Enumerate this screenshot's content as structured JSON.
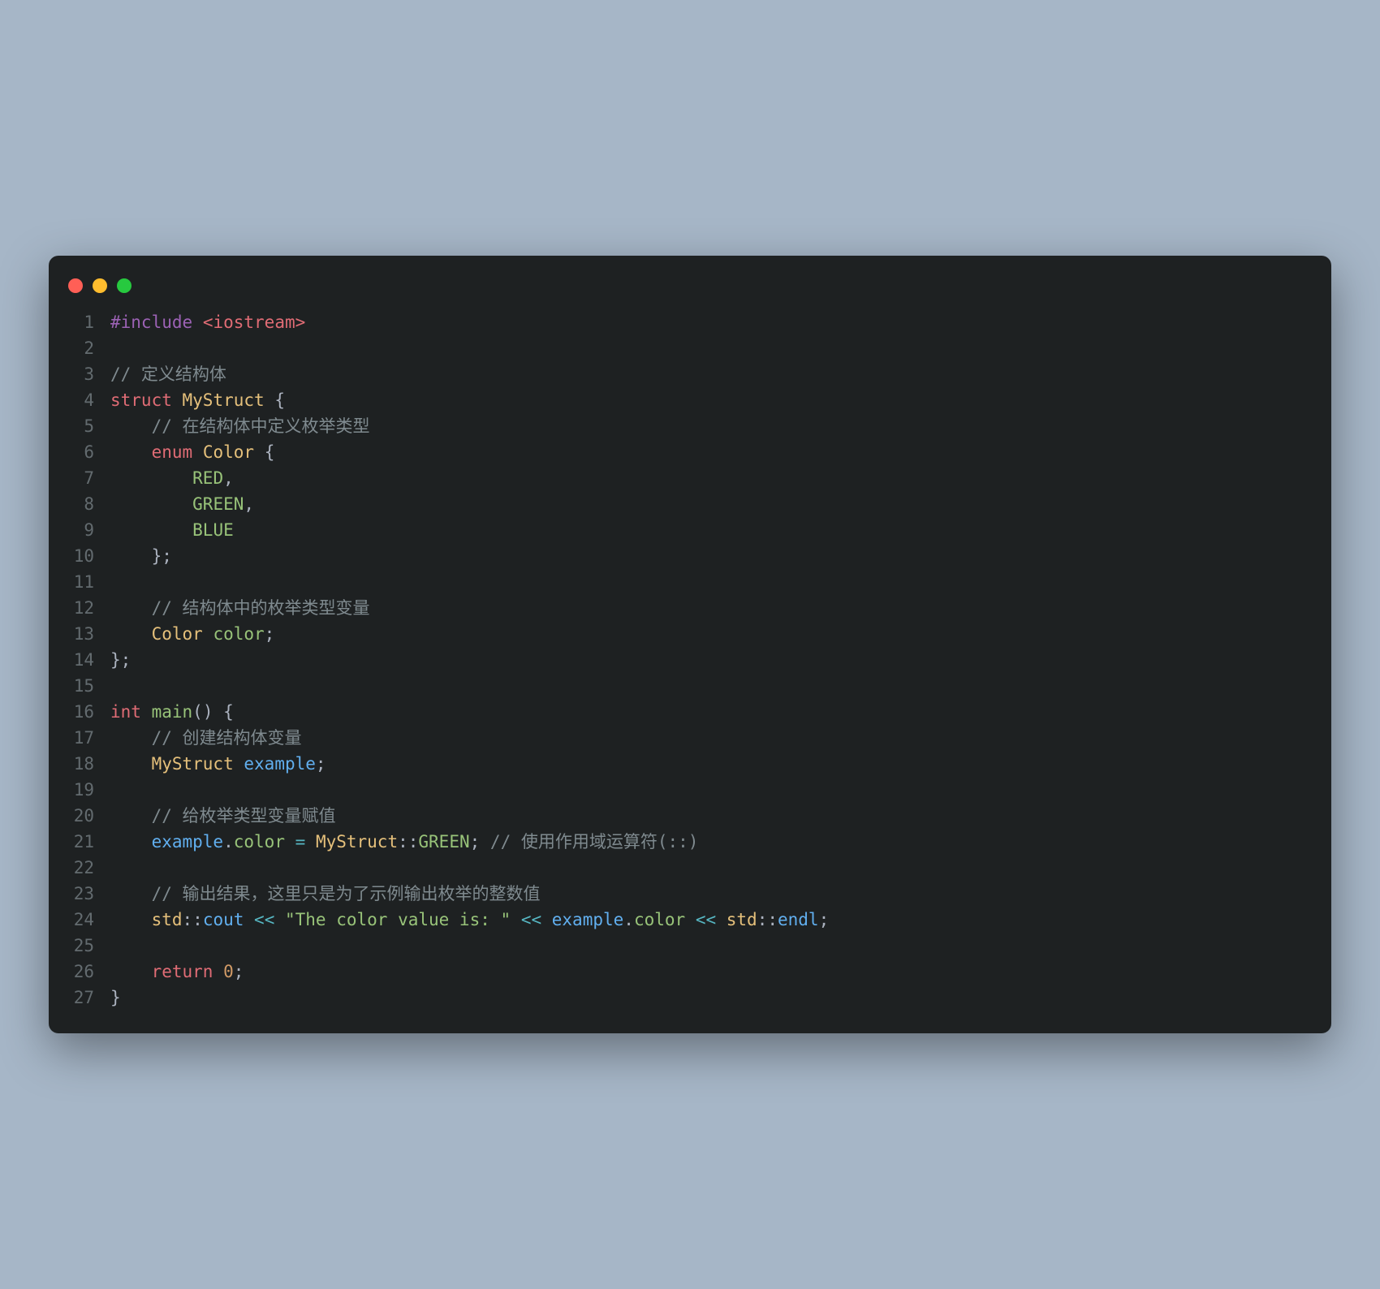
{
  "window": {
    "traffic": [
      "red",
      "yellow",
      "green"
    ]
  },
  "lines": [
    {
      "n": "1",
      "html": "<span class='preproc'>#include</span> <span class='include-path'>&lt;iostream&gt;</span>"
    },
    {
      "n": "2",
      "html": ""
    },
    {
      "n": "3",
      "html": "<span class='comment'>// 定义结构体</span>"
    },
    {
      "n": "4",
      "html": "<span class='keyword-red'>struct</span> <span class='type'>MyStruct</span> <span class='punct'>{</span>"
    },
    {
      "n": "5",
      "html": "    <span class='comment'>// 在结构体中定义枚举类型</span>"
    },
    {
      "n": "6",
      "html": "    <span class='keyword-red'>enum</span> <span class='type'>Color</span> <span class='punct'>{</span>"
    },
    {
      "n": "7",
      "html": "        <span class='const'>RED</span><span class='punct'>,</span>"
    },
    {
      "n": "8",
      "html": "        <span class='const'>GREEN</span><span class='punct'>,</span>"
    },
    {
      "n": "9",
      "html": "        <span class='const'>BLUE</span>"
    },
    {
      "n": "10",
      "html": "    <span class='punct'>};</span>"
    },
    {
      "n": "11",
      "html": ""
    },
    {
      "n": "12",
      "html": "    <span class='comment'>// 结构体中的枚举类型变量</span>"
    },
    {
      "n": "13",
      "html": "    <span class='type'>Color</span> <span class='member'>color</span><span class='punct'>;</span>"
    },
    {
      "n": "14",
      "html": "<span class='punct'>};</span>"
    },
    {
      "n": "15",
      "html": ""
    },
    {
      "n": "16",
      "html": "<span class='keyword-red'>int</span> <span class='func'>main</span><span class='punct'>()</span> <span class='punct'>{</span>"
    },
    {
      "n": "17",
      "html": "    <span class='comment'>// 创建结构体变量</span>"
    },
    {
      "n": "18",
      "html": "    <span class='type'>MyStruct</span> <span class='var'>example</span><span class='punct'>;</span>"
    },
    {
      "n": "19",
      "html": ""
    },
    {
      "n": "20",
      "html": "    <span class='comment'>// 给枚举类型变量赋值</span>"
    },
    {
      "n": "21",
      "html": "    <span class='var'>example</span><span class='punct'>.</span><span class='member'>color</span> <span class='op'>=</span> <span class='type'>MyStruct</span><span class='punct'>::</span><span class='const'>GREEN</span><span class='punct'>;</span> <span class='comment'>// 使用作用域运算符(::)</span>"
    },
    {
      "n": "22",
      "html": ""
    },
    {
      "n": "23",
      "html": "    <span class='comment'>// 输出结果，这里只是为了示例输出枚举的整数值</span>"
    },
    {
      "n": "24",
      "html": "    <span class='namespace'>std</span><span class='punct'>::</span><span class='var'>cout</span> <span class='op'>&lt;&lt;</span> <span class='string'>\"The color value is: \"</span> <span class='op'>&lt;&lt;</span> <span class='var'>example</span><span class='punct'>.</span><span class='member'>color</span> <span class='op'>&lt;&lt;</span> <span class='namespace'>std</span><span class='punct'>::</span><span class='var'>endl</span><span class='punct'>;</span>"
    },
    {
      "n": "25",
      "html": ""
    },
    {
      "n": "26",
      "html": "    <span class='keyword-red'>return</span> <span class='number'>0</span><span class='punct'>;</span>"
    },
    {
      "n": "27",
      "html": "<span class='punct'>}</span>"
    }
  ]
}
